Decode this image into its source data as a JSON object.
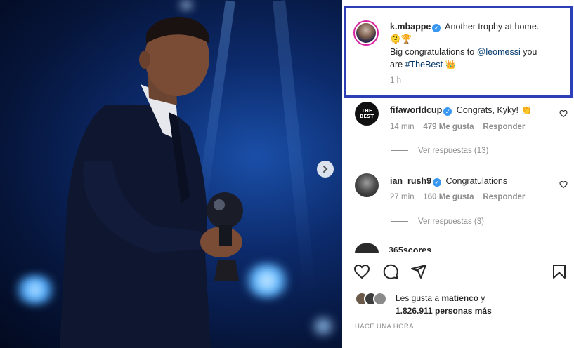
{
  "post": {
    "caption": {
      "username": "k.mbappe",
      "line1_text": "Another trophy at home.",
      "line1_emoji": "🫠🏆",
      "line2_prefix": "Big congratulations to",
      "mention": "@leomessi",
      "line2_suffix": "you",
      "line3_prefix": "are",
      "hashtag": "#TheBest",
      "line3_emoji": "👑",
      "time": "1 h"
    },
    "comments": [
      {
        "username": "fifaworldcup",
        "avatar_text": "THE BEST",
        "text": "Congrats, Kyky! 👏",
        "time": "14 min",
        "likes": "479 Me gusta",
        "reply_label": "Responder",
        "view_replies": "Ver respuestas (13)"
      },
      {
        "username": "ian_rush9",
        "text": "Congratulations",
        "time": "27 min",
        "likes": "160 Me gusta",
        "reply_label": "Responder",
        "view_replies": "Ver respuestas (3)"
      },
      {
        "partial_text": "365scores..."
      }
    ],
    "likes": {
      "prefix": "Les gusta a",
      "user": "matienco",
      "and": "y",
      "count": "1.826.911 personas más"
    },
    "posted": "HACE UNA HORA"
  },
  "icons": {
    "verified": "verified-badge-icon",
    "like": "heart-icon",
    "comment": "comment-icon",
    "share": "send-icon",
    "save": "bookmark-icon",
    "next": "chevron-right-icon"
  },
  "colors": {
    "highlight_border": "#2c3eb8",
    "verified": "#3897f0",
    "link": "#00376b",
    "meta": "#8e8e8e"
  }
}
